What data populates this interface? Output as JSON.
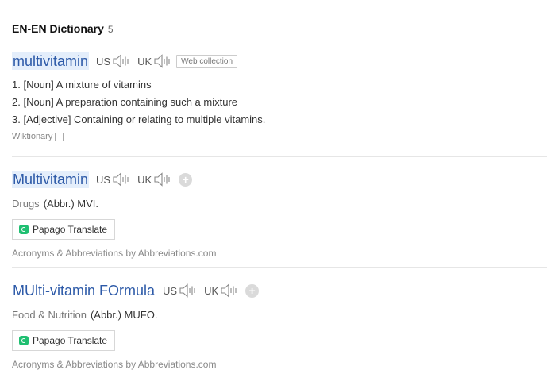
{
  "header": {
    "title": "EN-EN Dictionary",
    "count": "5"
  },
  "pron": {
    "us": "US",
    "uk": "UK"
  },
  "entries": [
    {
      "headword": "multivitamin",
      "badge": "Web collection",
      "definitions": [
        "1. [Noun] A mixture of vitamins",
        "2. [Noun] A preparation containing such a mixture",
        "3. [Adjective] Containing or relating to multiple vitamins."
      ],
      "source": "Wiktionary"
    },
    {
      "headword": "Multivitamin",
      "category": "Drugs",
      "abbr": "(Abbr.) MVI.",
      "translate": "Papago Translate",
      "attribution": "Acronyms & Abbreviations by Abbreviations.com"
    },
    {
      "headword": "MUlti-vitamin FOrmula",
      "category": "Food & Nutrition",
      "abbr": "(Abbr.) MUFO.",
      "translate": "Papago Translate",
      "attribution": "Acronyms & Abbreviations by Abbreviations.com"
    }
  ],
  "icons": {
    "speaker": "speaker-icon",
    "plus": "plus-icon",
    "copy": "copy-icon",
    "papago": "papago-icon"
  },
  "colors": {
    "headword": "#2d5aa8",
    "highlight": "#e4eefb",
    "papago": "#1fbf71"
  }
}
